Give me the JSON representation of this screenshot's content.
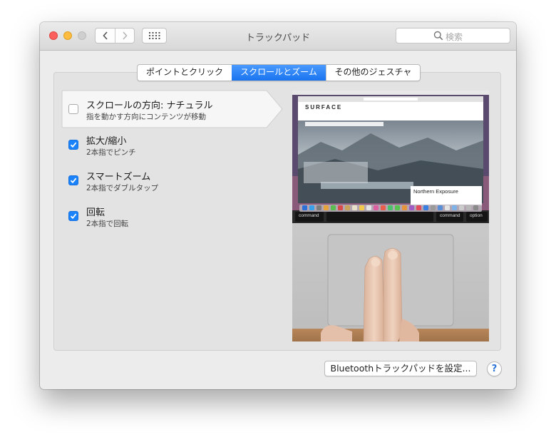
{
  "window": {
    "title": "トラックパッド"
  },
  "search": {
    "placeholder": "検索"
  },
  "tabs": [
    {
      "label": "ポイントとクリック",
      "selected": false
    },
    {
      "label": "スクロールとズーム",
      "selected": true
    },
    {
      "label": "その他のジェスチャ",
      "selected": false
    }
  ],
  "options": [
    {
      "title": "スクロールの方向: ナチュラル",
      "description": "指を動かす方向にコンテンツが移動",
      "checked": false,
      "selected": true
    },
    {
      "title": "拡大/縮小",
      "description": "2本指でピンチ",
      "checked": true
    },
    {
      "title": "スマートズーム",
      "description": "2本指でダブルタップ",
      "checked": true
    },
    {
      "title": "回転",
      "description": "2本指で回転",
      "checked": true
    }
  ],
  "preview": {
    "site_logo": "SURFACE",
    "card_title": "Northern Exposure",
    "keys": {
      "left_command": "command",
      "right_command": "command",
      "option": "option"
    }
  },
  "buttons": {
    "bluetooth": "Bluetoothトラックパッドを設定...",
    "help": "?"
  },
  "colors": {
    "accent": "#1a74f0",
    "checkbox": "#1a82fb"
  }
}
